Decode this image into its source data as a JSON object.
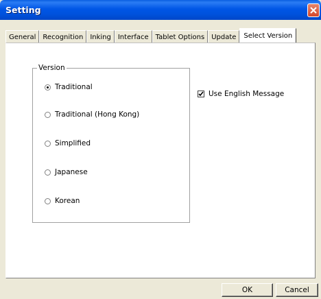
{
  "window": {
    "title": "Setting"
  },
  "tabs": [
    {
      "label": "General",
      "active": false
    },
    {
      "label": "Recognition",
      "active": false
    },
    {
      "label": "Inking",
      "active": false
    },
    {
      "label": "Interface",
      "active": false
    },
    {
      "label": "Tablet Options",
      "active": false
    },
    {
      "label": "Update",
      "active": false
    },
    {
      "label": "Select Version",
      "active": true
    }
  ],
  "version_group": {
    "legend": "Version",
    "options": [
      {
        "label": "Traditional",
        "selected": true
      },
      {
        "label": "Traditional (Hong Kong)",
        "selected": false
      },
      {
        "label": "Simplified",
        "selected": false
      },
      {
        "label": "Japanese",
        "selected": false
      },
      {
        "label": "Korean",
        "selected": false
      }
    ]
  },
  "use_english": {
    "label": "Use English Message",
    "checked": true
  },
  "buttons": {
    "ok": "OK",
    "cancel": "Cancel"
  },
  "colors": {
    "titlebar": "#0054e3",
    "close": "#d5472b",
    "face": "#ece9d8"
  }
}
